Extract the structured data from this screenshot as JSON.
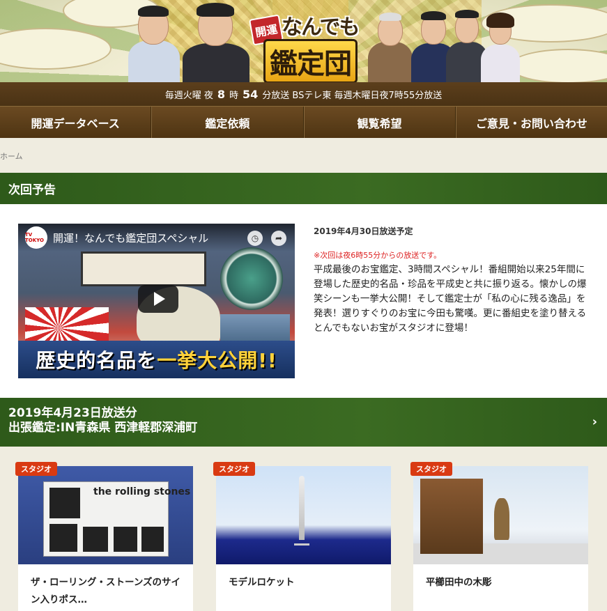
{
  "header": {
    "logo_kaiun": "開運",
    "logo_nandemo": "なんでも",
    "logo_kanteidan": "鑑定団"
  },
  "schedule": {
    "part1": "毎週火曜 夜",
    "hour": "8",
    "part2": "時",
    "minute": "54",
    "part3": "分放送 BSテレ東 毎週木曜日夜7時55分放送"
  },
  "nav": {
    "items": [
      {
        "label": "開運データベース"
      },
      {
        "label": "鑑定依頼"
      },
      {
        "label": "観覧希望"
      },
      {
        "label": "ご意見・お問い合わせ"
      }
    ]
  },
  "breadcrumb": {
    "home": "ホーム"
  },
  "next_section": {
    "heading": "次回予告",
    "video": {
      "channel": "TV TOKYO",
      "title": "開運！なんでも鑑定団スペシャル",
      "caption_a": "歴史的名品を",
      "caption_b": "一挙大公開!!"
    },
    "date": "2019年4月30日放送予定",
    "note": "※次回は夜6時55分からの放送です。",
    "description": "平成最後のお宝鑑定、3時間スペシャル！番組開始以来25年間に登場した歴史的名品・珍品を平成史と共に振り返る。懐かしの爆笑シーンも一挙大公開！そして鑑定士が「私の心に残る逸品」を発表！選りすぐりのお宝に今田も驚嘆。更に番組史を塗り替えるとんでもないお宝がスタジオに登場！"
  },
  "episode_section": {
    "line1": "2019年4月23日放送分",
    "line2": "出張鑑定:IN青森県 西津軽郡深浦町"
  },
  "cards": [
    {
      "tag": "スタジオ",
      "title": "ザ・ローリング・ストーンズのサイン入りポス…",
      "poster_text": "the rolling stones"
    },
    {
      "tag": "スタジオ",
      "title": "モデルロケット"
    },
    {
      "tag": "スタジオ",
      "title": "平櫛田中の木彫"
    }
  ]
}
